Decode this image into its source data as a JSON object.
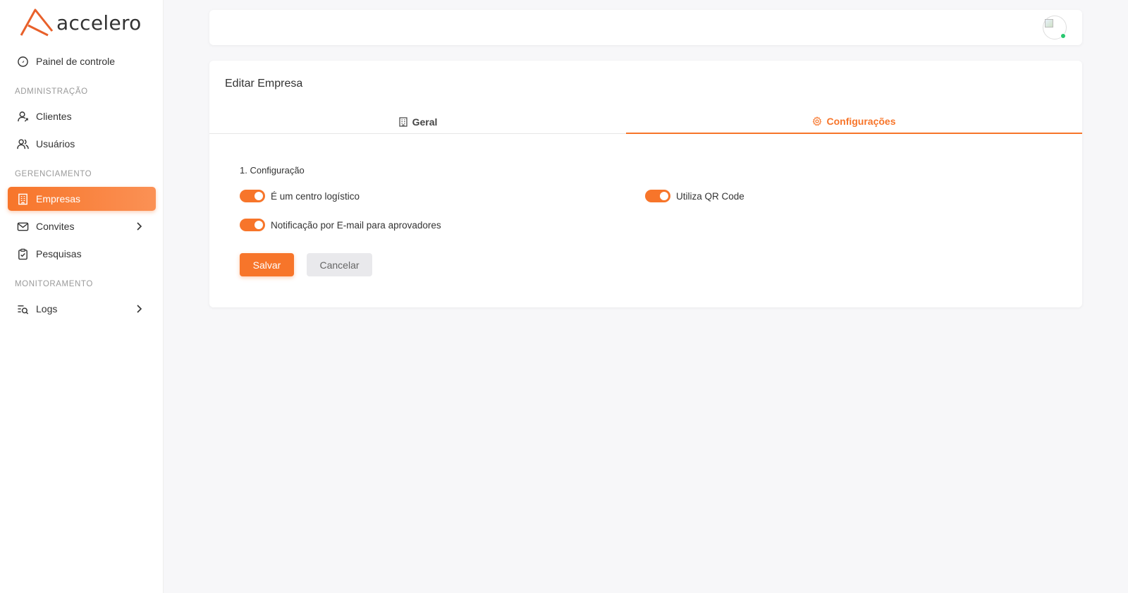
{
  "brand": {
    "name": "accelero",
    "accent": "#f7752a"
  },
  "sidebar": {
    "dashboard": {
      "label": "Painel de controle",
      "icon": "dashboard-icon"
    },
    "sections": [
      {
        "label": "ADMINISTRAÇÃO"
      },
      {
        "label": "GERENCIAMENTO"
      },
      {
        "label": "MONITORAMENTO"
      }
    ],
    "items": [
      {
        "label": "Clientes",
        "icon": "user-icon"
      },
      {
        "label": "Usuários",
        "icon": "users-icon"
      },
      {
        "label": "Empresas",
        "icon": "building-icon",
        "active": true
      },
      {
        "label": "Convites",
        "icon": "mail-icon",
        "has_submenu": true
      },
      {
        "label": "Pesquisas",
        "icon": "clipboard-icon"
      },
      {
        "label": "Logs",
        "icon": "logs-search-icon",
        "has_submenu": true
      }
    ]
  },
  "topbar": {
    "avatar_status": "online"
  },
  "card": {
    "title": "Editar Empresa",
    "tabs": [
      {
        "label": "Geral",
        "icon": "building-icon",
        "active": false
      },
      {
        "label": "Configurações",
        "icon": "gear-icon",
        "active": true
      }
    ],
    "section_title": "1. Configuração",
    "toggles": [
      {
        "label": "É um centro logístico",
        "checked": true
      },
      {
        "label": "Utiliza QR Code",
        "checked": true
      },
      {
        "label": "Notificação por E-mail para aprovadores",
        "checked": true
      }
    ],
    "buttons": {
      "save": "Salvar",
      "cancel": "Cancelar"
    }
  }
}
